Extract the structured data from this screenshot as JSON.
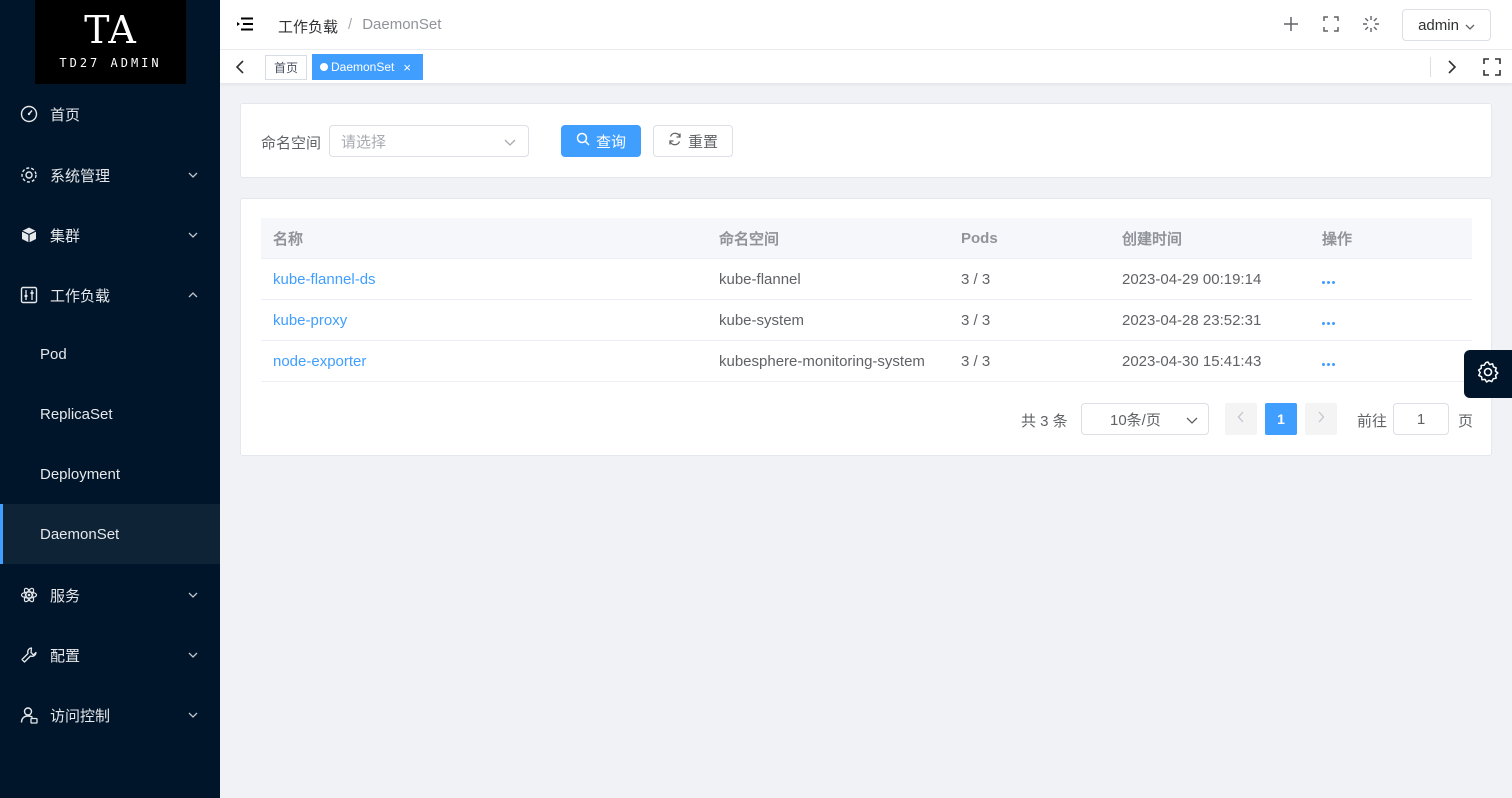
{
  "logo": {
    "big": "TA",
    "small": "TD27 ADMIN"
  },
  "sidebar": {
    "items": [
      {
        "label": "首页",
        "icon": "dashboard-icon"
      },
      {
        "label": "系统管理",
        "icon": "gear-icon"
      },
      {
        "label": "集群",
        "icon": "cube-icon"
      },
      {
        "label": "工作负载",
        "icon": "sliders-icon"
      },
      {
        "label": "服务",
        "icon": "atom-icon"
      },
      {
        "label": "配置",
        "icon": "wrench-icon"
      },
      {
        "label": "访问控制",
        "icon": "user-lock-icon"
      }
    ],
    "subitems": [
      {
        "label": "Pod"
      },
      {
        "label": "ReplicaSet"
      },
      {
        "label": "Deployment"
      },
      {
        "label": "DaemonSet",
        "active": true
      }
    ]
  },
  "header": {
    "breadcrumb": [
      "工作负载",
      "DaemonSet"
    ],
    "user": "admin"
  },
  "tabs": {
    "home": "首页",
    "active": "DaemonSet"
  },
  "search": {
    "namespace_label": "命名空间",
    "namespace_placeholder": "请选择",
    "query_label": "查询",
    "reset_label": "重置"
  },
  "table": {
    "columns": [
      "名称",
      "命名空间",
      "Pods",
      "创建时间",
      "操作"
    ],
    "rows": [
      {
        "name": "kube-flannel-ds",
        "namespace": "kube-flannel",
        "pods": "3 / 3",
        "created": "2023-04-29 00:19:14"
      },
      {
        "name": "kube-proxy",
        "namespace": "kube-system",
        "pods": "3 / 3",
        "created": "2023-04-28 23:52:31"
      },
      {
        "name": "node-exporter",
        "namespace": "kubesphere-monitoring-system",
        "pods": "3 / 3",
        "created": "2023-04-30 15:41:43"
      }
    ]
  },
  "pagination": {
    "total": "共 3 条",
    "page_size": "10条/页",
    "current_page": "1",
    "goto_label": "前往",
    "goto_value": "1",
    "page_unit": "页"
  },
  "colors": {
    "primary": "#409eff",
    "sidebar_bg": "#001529"
  }
}
